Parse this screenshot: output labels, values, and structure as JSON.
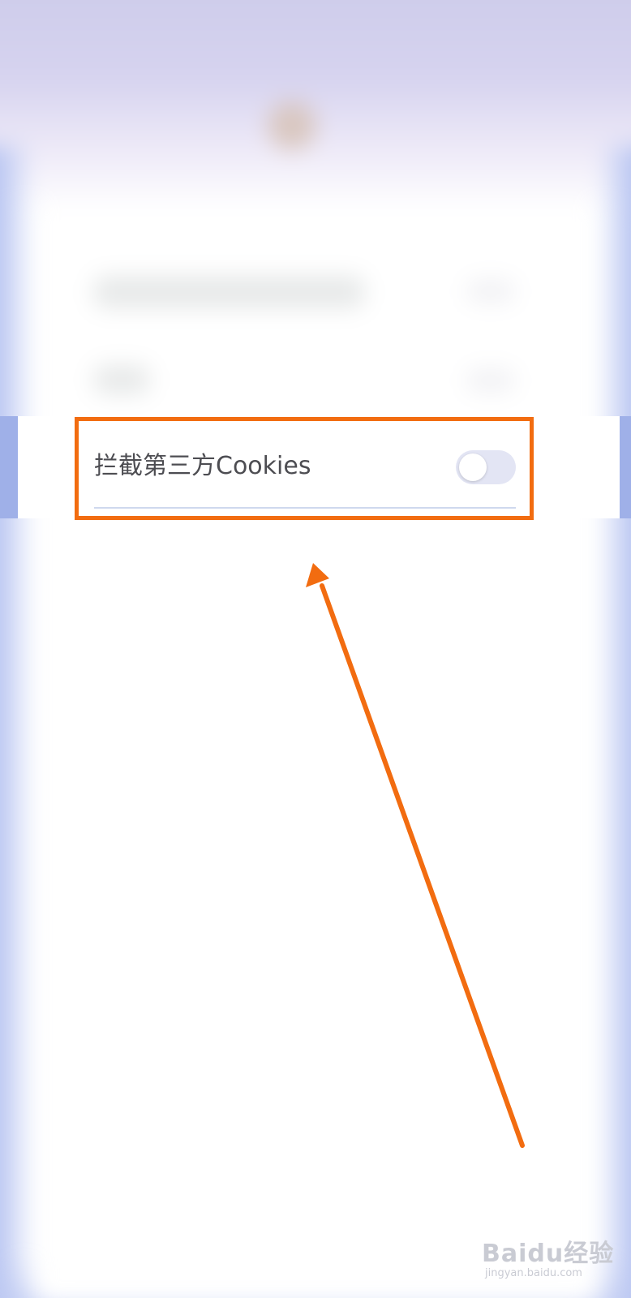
{
  "settings": {
    "block_third_party_cookies": {
      "label": "拦截第三方Cookies",
      "enabled": false
    }
  },
  "colors": {
    "annotation": "#f26c10",
    "toggle_track": "#e3e5f4",
    "label_text": "#4d4d52",
    "edge_blue": "#9fb0e8"
  },
  "watermark": {
    "brand": "Baidu经验",
    "site": "jingyan.baidu.com"
  }
}
